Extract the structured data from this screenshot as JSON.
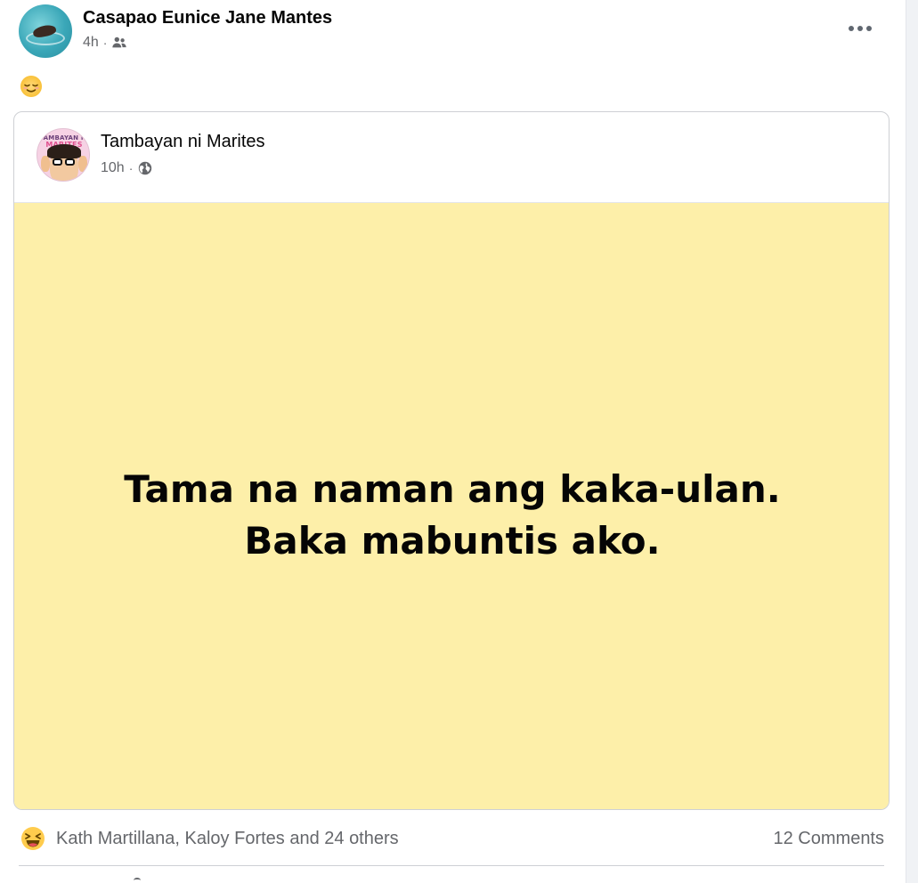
{
  "post": {
    "author": "Casapao Eunice Jane Mantes",
    "time": "4h",
    "separator": "·",
    "audience_icon": "friends-icon",
    "caption_emoji": "relieved-face-emoji",
    "more_icon": "more-options-icon"
  },
  "shared": {
    "page_name": "Tambayan ni Marites",
    "time": "10h",
    "separator": "·",
    "audience_icon": "globe-icon",
    "avatar_logo_line1": "TAMBAYAN NI",
    "avatar_logo_line2": "MARITES",
    "status_lines": [
      "Tama na naman ang kaka-ulan.",
      "Baka mabuntis ako."
    ],
    "status_background": "#fdefa9"
  },
  "reactions": {
    "icon": "laughing-face-emoji",
    "names": "Kath Martillana, Kaloy Fortes and 24 others",
    "comments": "12 Comments"
  },
  "colors": {
    "secondary_text": "#65676b",
    "primary_text": "#050505",
    "border": "#ced0d4"
  }
}
